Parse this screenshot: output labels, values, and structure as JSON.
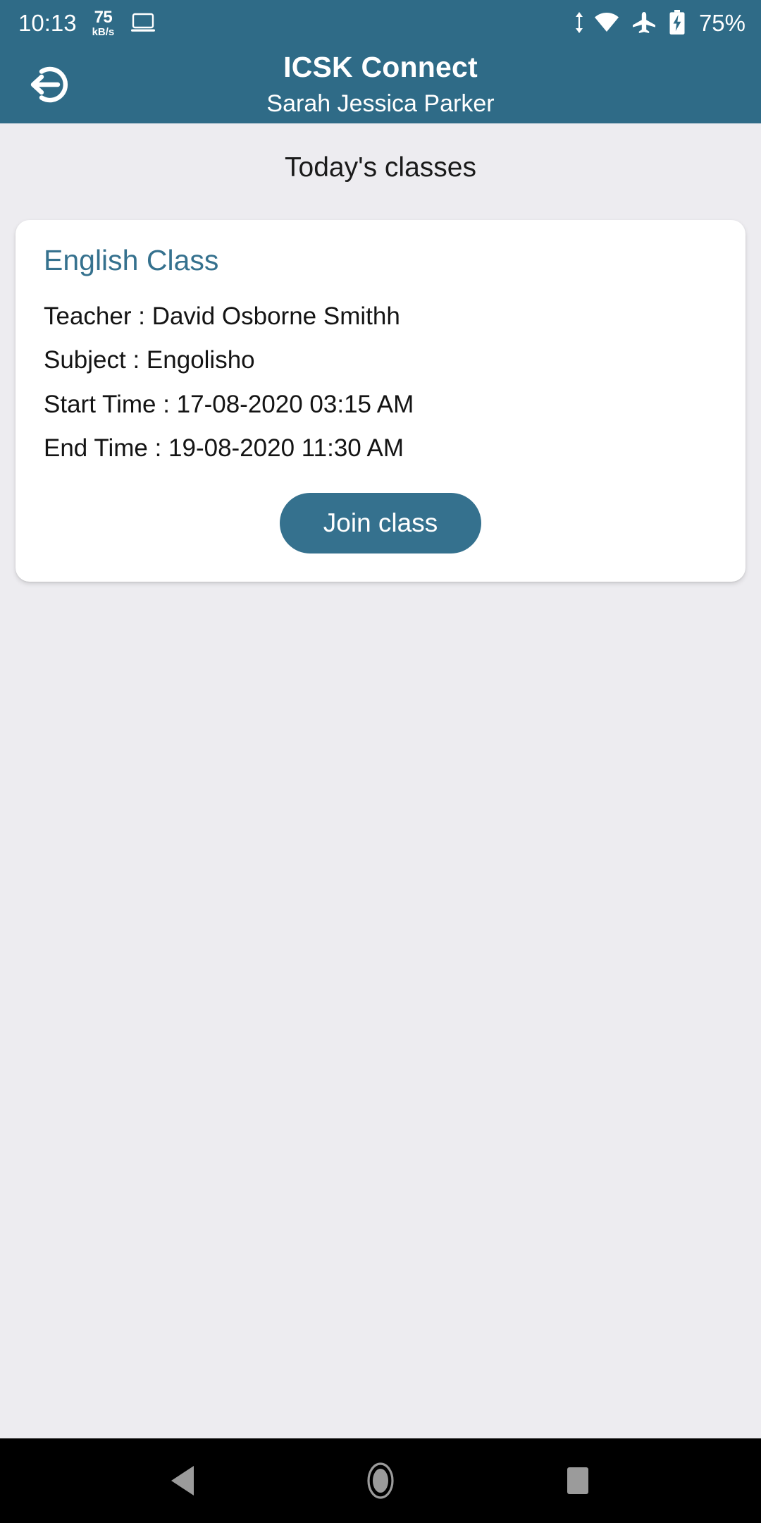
{
  "status_bar": {
    "clock": "10:13",
    "network_speed_value": "75",
    "network_speed_unit": "kB/s",
    "cast_icon": "laptop-icon",
    "data_transfer_icon": "up-down-arrows-icon",
    "wifi_icon": "wifi-icon",
    "airplane_icon": "airplane-mode-icon",
    "battery_icon": "battery-charging-icon",
    "battery_percent": "75%"
  },
  "app_bar": {
    "logout_icon": "logout-icon",
    "title": "ICSK Connect",
    "subtitle": "Sarah Jessica Parker",
    "background_color": "#2f6b87"
  },
  "main": {
    "section_title": "Today's classes",
    "classes": [
      {
        "name": "English Class",
        "teacher_line": "Teacher : David Osborne Smithh",
        "subject_line": "Subject : Engolisho",
        "start_time_line": "Start Time : 17-08-2020 03:15 AM",
        "end_time_line": "End Time : 19-08-2020 11:30 AM",
        "join_label": "Join class"
      }
    ]
  },
  "nav_bar": {
    "back_icon": "back-triangle-icon",
    "home_icon": "home-circle-icon",
    "recents_icon": "recents-square-icon"
  },
  "theme": {
    "accent": "#35718e",
    "header": "#2f6b87",
    "page_background": "#edecf0",
    "card_background": "#ffffff",
    "text": "#141414"
  }
}
